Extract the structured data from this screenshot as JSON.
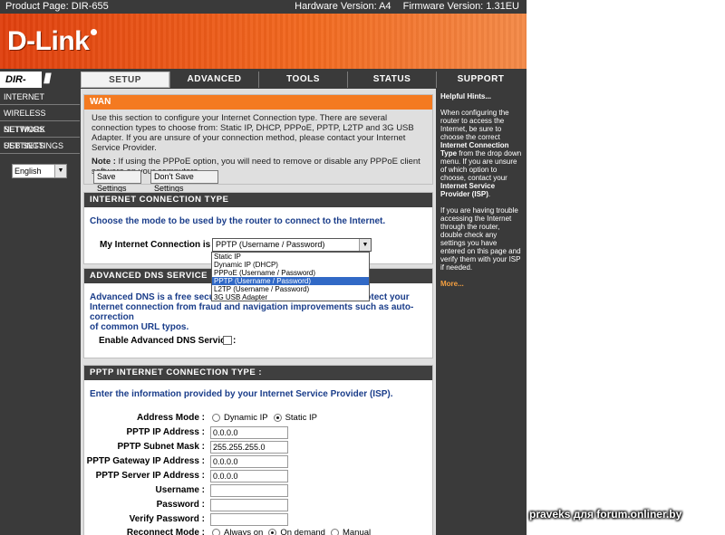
{
  "header": {
    "product_page": "Product Page: DIR-655",
    "hardware_version": "Hardware Version: A4",
    "firmware_version": "Firmware Version: 1.31EU",
    "logo": "D-Link"
  },
  "model": "DIR-655",
  "tabs": [
    {
      "label": "SETUP",
      "active": true
    },
    {
      "label": "ADVANCED",
      "active": false
    },
    {
      "label": "TOOLS",
      "active": false
    },
    {
      "label": "STATUS",
      "active": false
    },
    {
      "label": "SUPPORT",
      "active": false
    }
  ],
  "sidebar": {
    "items": [
      {
        "label": "INTERNET"
      },
      {
        "label": "WIRELESS SETTINGS"
      },
      {
        "label": "NETWORK SETTINGS"
      },
      {
        "label": "USB SETTINGS"
      }
    ],
    "language": "English"
  },
  "wan": {
    "title": "WAN",
    "intro": "Use this section to configure your Internet Connection type. There are several connection types to choose from: Static IP, DHCP, PPPoE, PPTP, L2TP and 3G USB Adapter. If you are unsure of your connection method, please contact your Internet Service Provider.",
    "note_label": "Note :",
    "note": " If using the PPPoE option, you will need to remove or disable any PPPoE client software on your computers.",
    "save_label": "Save Settings",
    "dont_save_label": "Don't Save Settings"
  },
  "connection_type": {
    "title": "INTERNET CONNECTION TYPE",
    "choose": "Choose the mode to be used by the router to connect to the Internet.",
    "label": "My Internet Connection is :",
    "selected": "PPTP (Username / Password)",
    "options": [
      "Static IP",
      "Dynamic IP (DHCP)",
      "PPPoE (Username / Password)",
      "PPTP (Username / Password)",
      "L2TP (Username / Password)",
      "3G USB Adapter"
    ],
    "highlighted_index": 3
  },
  "advanced_dns": {
    "title": "ADVANCED DNS SERVICE",
    "desc_visible_start": "Advanced DNS is a free security",
    "desc_visible_end": "rotect your",
    "desc_line2": "Internet connection from fraud and navigation improvements such as auto-correction",
    "desc_line3": "of common URL typos.",
    "enable_label": "Enable Advanced DNS Service :",
    "enabled": false
  },
  "pptp": {
    "title": "PPTP INTERNET CONNECTION TYPE :",
    "enter": "Enter the information provided by your Internet Service Provider (ISP).",
    "address_mode_label": "Address Mode :",
    "address_mode_options": [
      "Dynamic IP",
      "Static IP"
    ],
    "address_mode_selected": "Static IP",
    "ip_label": "PPTP IP Address :",
    "ip_value": "0.0.0.0",
    "subnet_label": "PPTP Subnet Mask :",
    "subnet_value": "255.255.255.0",
    "gateway_label": "PPTP Gateway IP Address :",
    "gateway_value": "0.0.0.0",
    "server_label": "PPTP Server IP Address :",
    "server_value": "0.0.0.0",
    "username_label": "Username :",
    "username_value": "",
    "password_label": "Password :",
    "password_value": "",
    "verify_label": "Verify Password :",
    "verify_value": "",
    "reconnect_label": "Reconnect Mode :",
    "reconnect_options": [
      "Always on",
      "On demand",
      "Manual"
    ],
    "reconnect_selected": "On demand"
  },
  "hints": {
    "title": "Helpful Hints...",
    "p1_a": "When configuring the router to access the Internet, be sure to choose the correct ",
    "p1_b": "Internet Connection Type",
    "p1_c": " from the drop down menu. If you are unsure of which option to choose, contact your ",
    "p1_d": "Internet Service Provider (ISP)",
    "p1_e": ".",
    "p2": "If you are having trouble accessing the Internet through the router, double check any settings you have entered on this page and verify them with your ISP if needed.",
    "more": "More..."
  },
  "watermark": "praveks для forum.onliner.by",
  "colors": {
    "brand_orange": "#f26a20",
    "dark_frame": "#3a3a3a",
    "heading_blue": "#1a3d8a",
    "select_highlight": "#3169c6"
  }
}
